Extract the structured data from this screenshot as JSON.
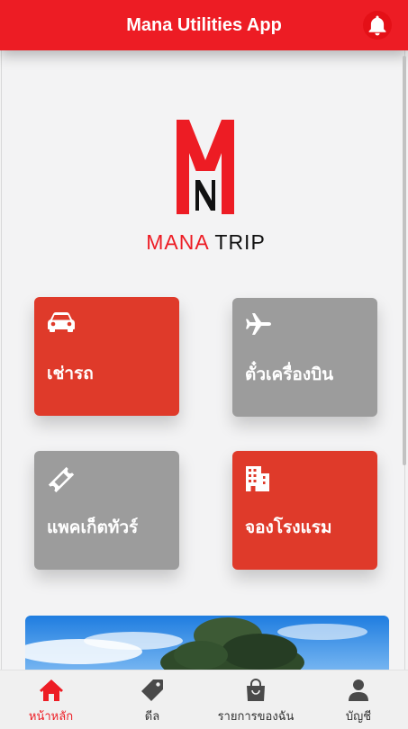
{
  "header": {
    "title": "Mana Utilities App",
    "notification_icon": "bell-icon"
  },
  "logo": {
    "initials": "MN",
    "brand_main": "MANA",
    "brand_sub": "TRIP"
  },
  "services": [
    {
      "label": "เช่ารถ",
      "icon": "car-icon",
      "color": "#df3a2a"
    },
    {
      "label": "ตั๋วเครื่องบิน",
      "icon": "airplane-icon",
      "color": "#9c9c9c"
    },
    {
      "label": "แพคเก็ตทัวร์",
      "icon": "ticket-icon",
      "color": "#9c9c9c"
    },
    {
      "label": "จองโรงแรม",
      "icon": "hotel-icon",
      "color": "#df3a2a"
    }
  ],
  "tabs": [
    {
      "label": "หน้าหลัก",
      "icon": "home-icon",
      "active": true
    },
    {
      "label": "ดีล",
      "icon": "tag-icon",
      "active": false
    },
    {
      "label": "รายการของฉัน",
      "icon": "shopping-bag-icon",
      "active": false
    },
    {
      "label": "บัญชี",
      "icon": "user-icon",
      "active": false
    }
  ],
  "colors": {
    "accent": "#ed1c24",
    "tile_red": "#df3a2a",
    "tile_gray": "#9c9c9c"
  }
}
